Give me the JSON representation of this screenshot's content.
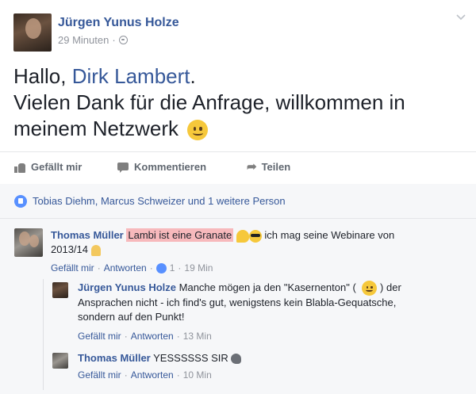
{
  "post": {
    "author": "Jürgen Yunus Holze",
    "time": "29 Minuten",
    "greeting": "Hallo, ",
    "mention": "Dirk Lambert",
    "greeting_end": ".",
    "line2": "Vielen Dank für die Anfrage, willkommen in",
    "line3": "meinem Netzwerk"
  },
  "actions": {
    "like": "Gefällt mir",
    "comment": "Kommentieren",
    "share": "Teilen"
  },
  "likes": {
    "text": "Tobias Diehm, Marcus Schweizer und 1 weitere Person"
  },
  "comments": [
    {
      "author": "Thomas Müller",
      "highlight": "Lambi ist eine Granate",
      "text_after": "ich mag seine Webinare von",
      "text_line2": "2013/14",
      "like": "Gefällt mir",
      "reply": "Antworten",
      "like_count": "1",
      "time": "19 Min"
    }
  ],
  "replies": [
    {
      "author": "Jürgen Yunus Holze",
      "text_line1_a": "Manche mögen ja den \"Kasernenton\" (",
      "text_line1_b": ") der",
      "text_line2": "Ansprachen nicht - ich find's gut, wenigstens kein Blabla-Gequatsche,",
      "text_line3": "sondern auf den Punkt!",
      "like": "Gefällt mir",
      "reply": "Antworten",
      "time": "13 Min"
    },
    {
      "author": "Thomas Müller",
      "text": "YESSSSSS SIR",
      "like": "Gefällt mir",
      "reply": "Antworten",
      "time": "10 Min"
    }
  ],
  "colors": {
    "link": "#365899",
    "meta": "#90949c",
    "highlight": "#f7b9bc",
    "like_blue": "#5890ff"
  }
}
